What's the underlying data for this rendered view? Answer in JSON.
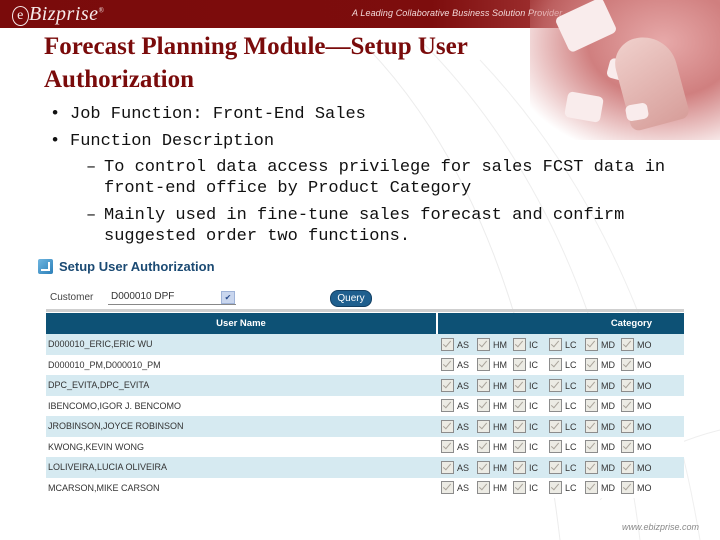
{
  "header": {
    "logo": "Bizprise",
    "logo_prefix": "e",
    "logo_mark": "®",
    "tagline": "A Leading Collaborative Business Solution Provider"
  },
  "title": {
    "line1": "Forecast Planning Module—Setup User",
    "line2": "Authorization"
  },
  "bullets": {
    "job_function": "Job Function: Front-End Sales",
    "function_description": "Function Description",
    "sub_items": [
      {
        "line1": "To control data access privilege for sales FCST data in",
        "line2": "front-end office by Product Category"
      },
      {
        "line1": "Mainly used in fine-tune sales forecast and confirm",
        "line2": "suggested order two functions."
      }
    ],
    "bullet_glyph": "•",
    "dash_glyph": "–"
  },
  "app": {
    "title": "Setup User Authorization",
    "customer_label": "Customer",
    "customer_value": "D000010 DPF",
    "dropdown_glyph": "✔",
    "query_label": "Query",
    "columns": {
      "user_name": "User Name",
      "category": "Category"
    },
    "category_codes": [
      "AS",
      "HM",
      "IC",
      "LC",
      "MD",
      "MO"
    ],
    "rows": [
      {
        "user": "D000010_ERIC,ERIC WU",
        "checked": [
          true,
          true,
          true,
          true,
          true,
          true
        ]
      },
      {
        "user": "D000010_PM,D000010_PM",
        "checked": [
          true,
          true,
          true,
          true,
          true,
          true
        ]
      },
      {
        "user": "DPC_EVITA,DPC_EVITA",
        "checked": [
          true,
          true,
          true,
          true,
          true,
          true
        ]
      },
      {
        "user": "IBENCOMO,IGOR J. BENCOMO",
        "checked": [
          true,
          true,
          true,
          true,
          true,
          true
        ]
      },
      {
        "user": "JROBINSON,JOYCE ROBINSON",
        "checked": [
          true,
          true,
          true,
          true,
          true,
          true
        ]
      },
      {
        "user": "KWONG,KEVIN WONG",
        "checked": [
          true,
          true,
          true,
          true,
          true,
          true
        ]
      },
      {
        "user": "LOLIVEIRA,LUCIA OLIVEIRA",
        "checked": [
          true,
          true,
          true,
          true,
          true,
          true
        ]
      },
      {
        "user": "MCARSON,MIKE CARSON",
        "checked": [
          true,
          true,
          true,
          true,
          true,
          true
        ]
      }
    ]
  },
  "footer": {
    "url": "www.ebizprise.com"
  },
  "colors": {
    "brand_red": "#7a0b0b",
    "header_blue": "#0d5175",
    "row_stripe": "#d6eaf1",
    "button_blue": "#1f5f8e"
  }
}
